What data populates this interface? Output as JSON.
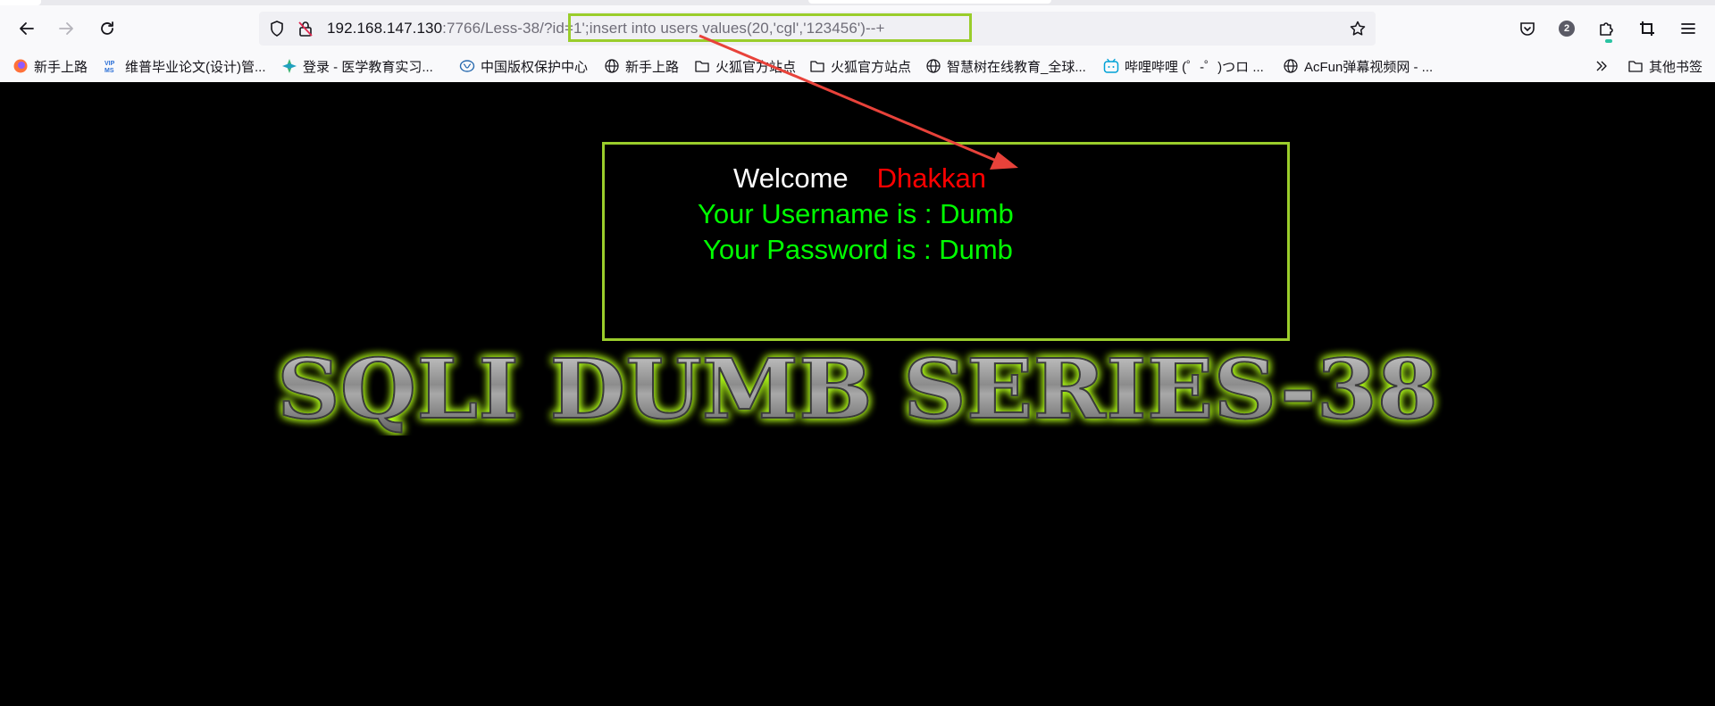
{
  "nav": {
    "back_icon": "arrow-left-icon",
    "forward_icon": "arrow-right-icon",
    "reload_icon": "reload-icon"
  },
  "url": {
    "host": "192.168.147.130",
    "rest": ":7766/Less-38/?id=1';insert into users values(20,'cgl','123456')--+"
  },
  "toolbar": {
    "extensions_badge": "2",
    "accent_color": "#2ac3a2"
  },
  "bookmarks": [
    {
      "label": "新手上路",
      "icon": "firefox-icon"
    },
    {
      "label": "维普毕业论文(设计)管...",
      "icon": "vip-icon"
    },
    {
      "label": "登录 - 医学教育实习...",
      "icon": "medical-icon"
    },
    {
      "label": "中国版权保护中心",
      "icon": "brain-icon"
    },
    {
      "label": "新手上路",
      "icon": "globe-icon"
    },
    {
      "label": "火狐官方站点",
      "icon": "folder-icon"
    },
    {
      "label": "火狐官方站点",
      "icon": "folder-icon"
    },
    {
      "label": "智慧树在线教育_全球...",
      "icon": "globe-icon"
    },
    {
      "label": "哔哩哔哩 (゜-゜)つロ ...",
      "icon": "bilibili-icon"
    },
    {
      "label": "AcFun弹幕视频网 - ...",
      "icon": "globe-icon"
    }
  ],
  "other_bookmarks": "其他书签",
  "page": {
    "welcome": "Welcome",
    "user_name": "Dhakkan",
    "username_line": "Your Username is : Dumb",
    "password_line": "Your Password is : Dumb",
    "banner": "SQLI DUMB SERIES-38",
    "highlight_color": "#9acd2b",
    "annotation_color": "#e8423a"
  }
}
